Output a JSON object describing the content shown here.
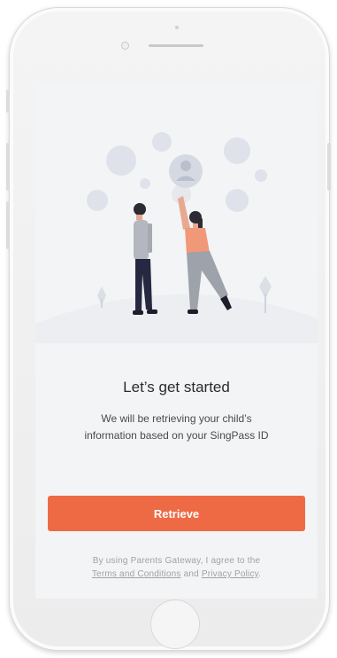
{
  "screen": {
    "heading": "Let’s get started",
    "description_line1": "We will be retrieving your child’s",
    "description_line2": "information based on your SingPass ID",
    "retrieve_button": "Retrieve"
  },
  "terms": {
    "prefix": "By using Parents Gateway, I agree to the",
    "terms_link": "Terms and Conditions",
    "and_text": "and",
    "privacy_link": "Privacy Policy",
    "suffix": "."
  },
  "colors": {
    "accent": "#ee6a44",
    "background": "#f3f4f6",
    "heading_text": "#2b2b2b",
    "muted_text": "#a2a2a2"
  },
  "icons": [
    "front-camera-icon",
    "earpiece-speaker-icon",
    "home-button-icon"
  ]
}
